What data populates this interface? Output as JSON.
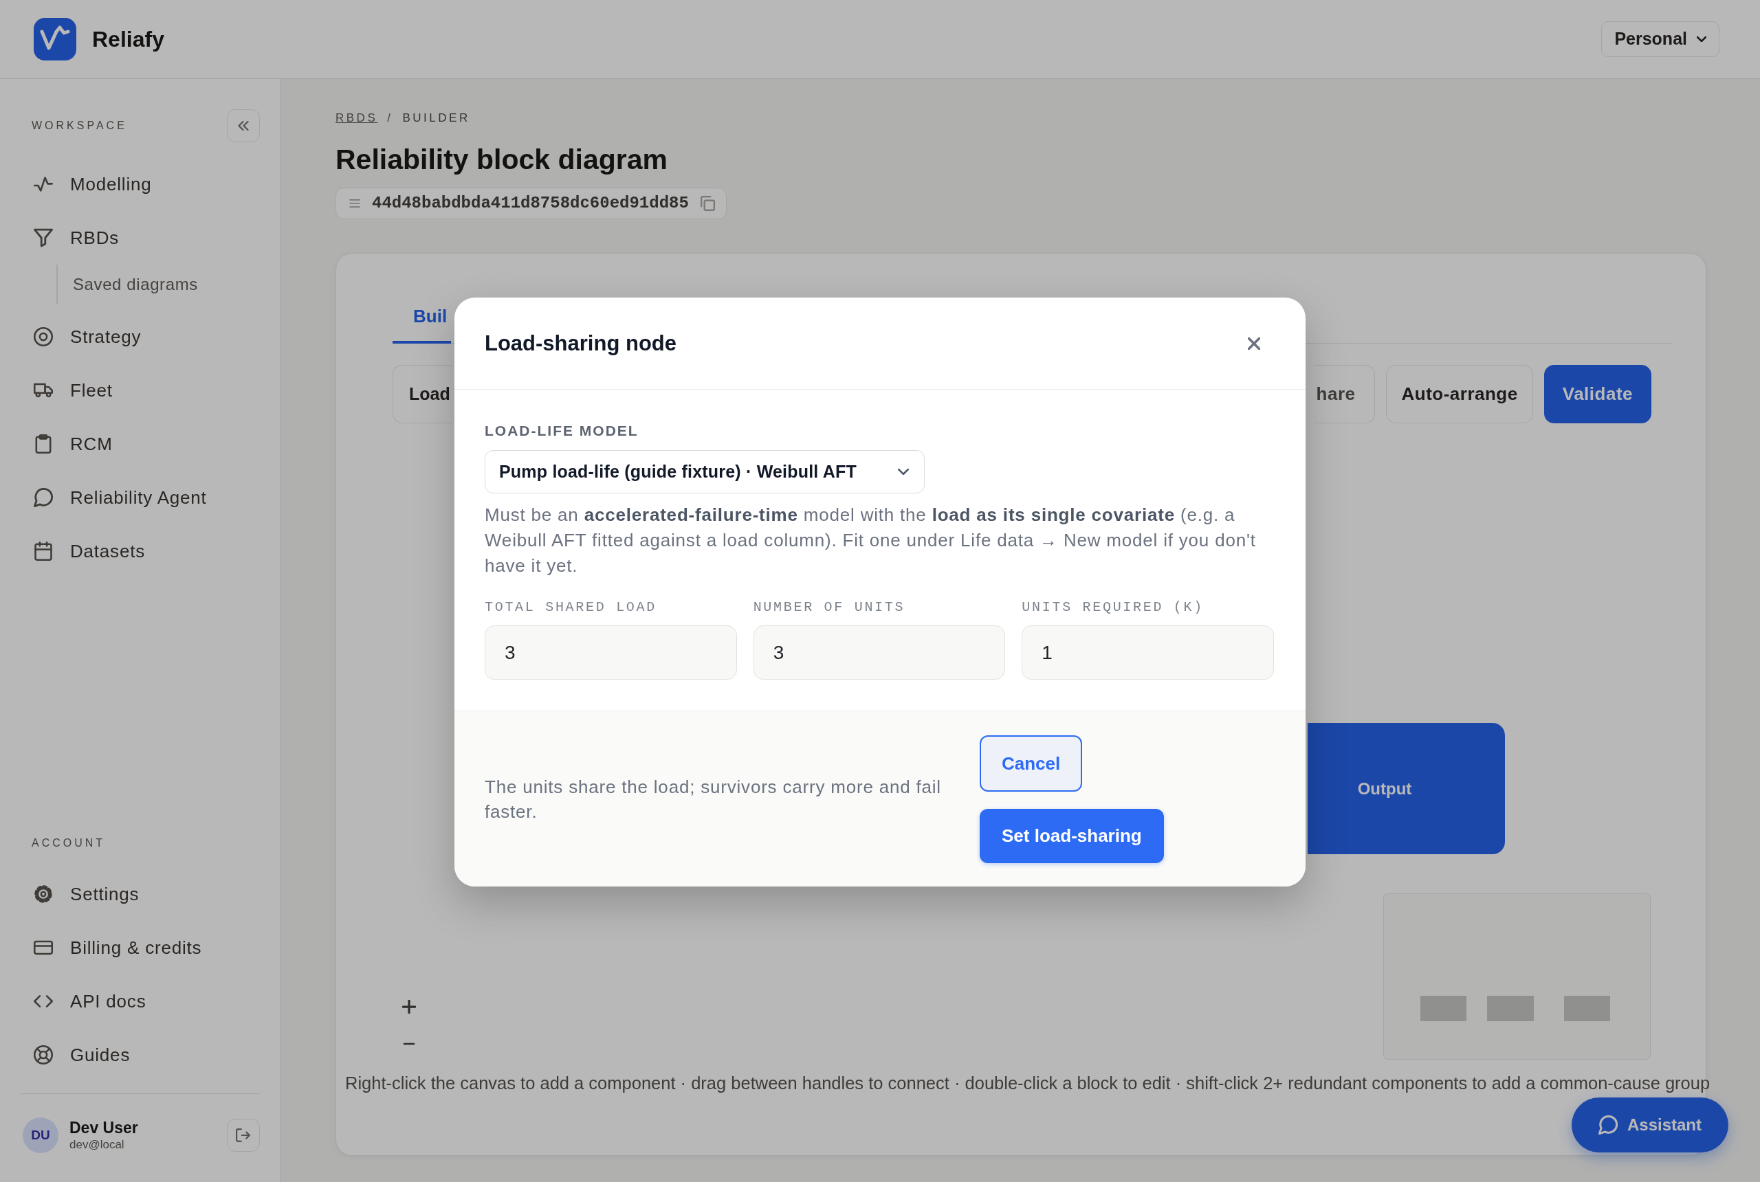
{
  "header": {
    "brand": "Reliafy",
    "workspace": "Personal"
  },
  "sidebar": {
    "sections": [
      {
        "title": "WORKSPACE",
        "items": [
          {
            "label": "Modelling"
          },
          {
            "label": "RBDs",
            "children": [
              {
                "label": "Saved diagrams"
              }
            ]
          },
          {
            "label": "Strategy"
          },
          {
            "label": "Fleet"
          },
          {
            "label": "RCM"
          },
          {
            "label": "Reliability Agent"
          },
          {
            "label": "Datasets"
          }
        ]
      },
      {
        "title": "ACCOUNT",
        "items": [
          {
            "label": "Settings"
          },
          {
            "label": "Billing & credits"
          },
          {
            "label": "API docs"
          },
          {
            "label": "Guides"
          }
        ]
      }
    ],
    "user": {
      "initials": "DU",
      "name": "Dev User",
      "email": "dev@local"
    }
  },
  "page": {
    "breadcrumb": {
      "items": [
        "RBDS",
        "BUILDER"
      ],
      "separator": "/"
    },
    "title": "Reliability block diagram",
    "reference": "44d48babdbda411d8758dc60ed91dd85"
  },
  "builder": {
    "tabs": [
      {
        "label": "Buil",
        "selected": true
      }
    ],
    "toolbar_left": [
      {
        "label": "Load",
        "kind": "outline"
      }
    ],
    "toolbar_right": [
      {
        "label": "hare",
        "kind": "outline"
      },
      {
        "label": "Auto-arrange",
        "kind": "outline"
      },
      {
        "label": "Validate",
        "kind": "primary"
      }
    ],
    "canvas": {
      "nodes": [
        {
          "label": "Output"
        }
      ],
      "hint": "Right-click the canvas to add a component · drag between handles to connect · double-click a block to edit · shift-click 2+ redundant components to add a common-cause group"
    }
  },
  "assistant": {
    "label": "Assistant"
  },
  "modal": {
    "title": "Load-sharing node",
    "model_field": {
      "label": "LOAD-LIFE MODEL",
      "value": "Pump load-life (guide fixture) · Weibull AFT"
    },
    "help": "Must be an **accelerated-failure-time** model with the **load as its single covariate** (e.g. a Weibull AFT fitted against a load column). Fit one under Life data → New model if you don't have it yet.",
    "fields": [
      {
        "label": "TOTAL SHARED LOAD",
        "value": "3"
      },
      {
        "label": "NUMBER OF UNITS",
        "value": "3"
      },
      {
        "label": "UNITS REQUIRED (K)",
        "value": "1"
      }
    ],
    "footer_note": "The units share the load; survivors carry more and fail faster.",
    "buttons": [
      {
        "label": "Cancel",
        "kind": "secondary"
      },
      {
        "label": "Set load-sharing",
        "kind": "primary"
      }
    ]
  }
}
